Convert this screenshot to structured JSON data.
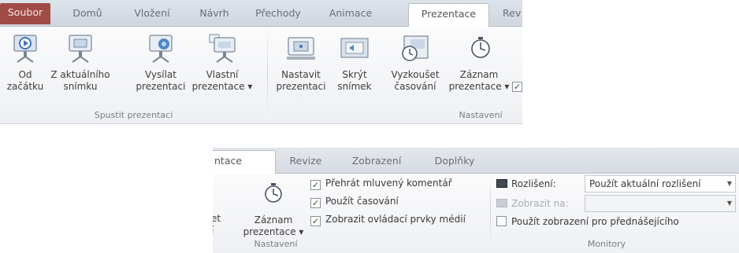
{
  "top_ribbon": {
    "tabs": [
      {
        "label": "Soubor"
      },
      {
        "label": "Domů"
      },
      {
        "label": "Vložení"
      },
      {
        "label": "Návrh"
      },
      {
        "label": "Přechody"
      },
      {
        "label": "Animace"
      },
      {
        "label": "Prezentace"
      },
      {
        "label": "Rev"
      }
    ],
    "active_tab": "Prezentace",
    "buttons": [
      {
        "line1": "Od",
        "line2": "začátku",
        "icon": "play-from-start-icon"
      },
      {
        "line1": "Z aktuálního",
        "line2": "snímku",
        "icon": "play-from-current-icon"
      },
      {
        "line1": "Vysílat",
        "line2": "prezentaci",
        "icon": "broadcast-slideshow-icon"
      },
      {
        "line1": "Vlastní",
        "line2": "prezentace ▾",
        "icon": "custom-slideshow-icon"
      },
      {
        "line1": "Nastavit",
        "line2": "prezentaci",
        "icon": "setup-slideshow-icon"
      },
      {
        "line1": "Skrýt",
        "line2": "snímek",
        "icon": "hide-slide-icon"
      },
      {
        "line1": "Vyzkoušet",
        "line2": "časování",
        "icon": "rehearse-timings-icon"
      },
      {
        "line1": "Záznam",
        "line2": "prezentace ▾",
        "icon": "record-slideshow-icon"
      }
    ],
    "groups": {
      "start": "Spustit prezentaci",
      "setup": "Nastavení"
    }
  },
  "bottom_ribbon": {
    "tabs": [
      {
        "label": "ntace"
      },
      {
        "label": "Revize"
      },
      {
        "label": "Zobrazení"
      },
      {
        "label": "Doplňky"
      }
    ],
    "record_button": {
      "line1": "Záznam",
      "line2": "prezentace ▾",
      "icon": "record-slideshow-icon"
    },
    "cut_text": {
      "line1": "et",
      "line2": "í"
    },
    "checkboxes": [
      {
        "label": "Přehrát mluvený komentář",
        "checked": true
      },
      {
        "label": "Použít časování",
        "checked": true
      },
      {
        "label": "Zobrazit ovládací prvky médií",
        "checked": true
      }
    ],
    "monitors": {
      "resolution_label": "Rozlišení:",
      "resolution_value": "Použít aktuální rozlišení",
      "show_on_label": "Zobrazit na:",
      "show_on_value": "",
      "presenter_view_label": "Použít zobrazení pro přednášejícího",
      "presenter_view_checked": false
    },
    "groups": {
      "setup": "Nastavení",
      "monitors": "Monitory"
    }
  },
  "colors": {
    "file_tab": "#a14b46",
    "tab_bar": "#d7dce3",
    "ribbon_body": "#f4f5f7"
  }
}
